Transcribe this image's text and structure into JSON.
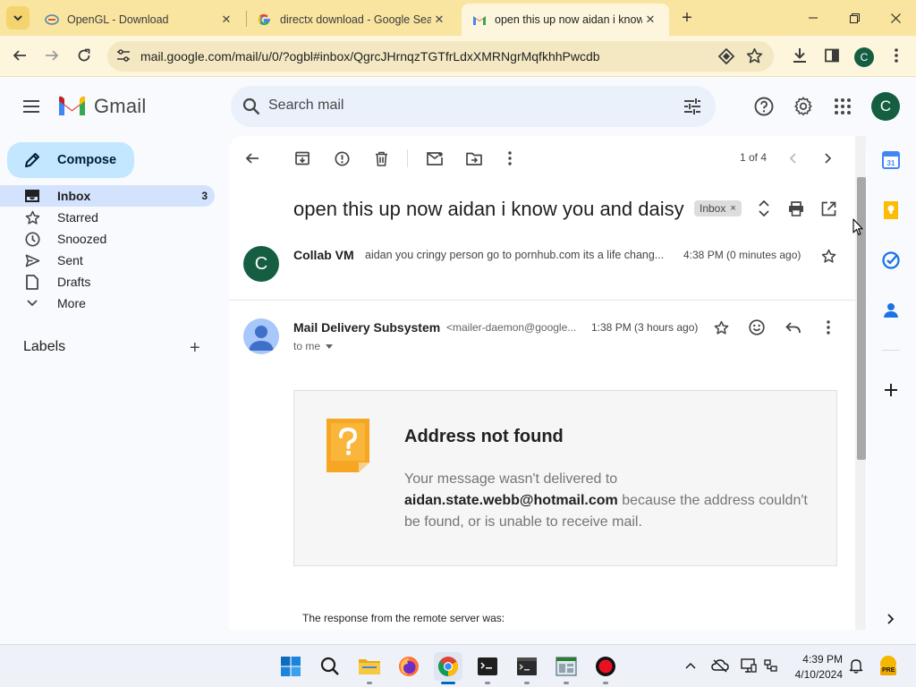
{
  "browser": {
    "tabs": [
      {
        "title": "OpenGL - Download",
        "favicon": "opengl-icon",
        "active": false
      },
      {
        "title": "directx download - Google Sea",
        "favicon": "google-icon",
        "active": false
      },
      {
        "title": "open this up now aidan i know",
        "favicon": "gmail-icon",
        "active": true
      }
    ],
    "close_glyph": "✕",
    "new_tab_glyph": "+",
    "url": "mail.google.com/mail/u/0/?ogbl#inbox/QgrcJHrnqzTGTfrLdxXMRNgrMqfkhhPwcdb",
    "profile_initial": "C"
  },
  "gmail": {
    "logo_text": "Gmail",
    "search_placeholder": "Search mail",
    "avatar_initial": "C",
    "compose_label": "Compose",
    "nav": [
      {
        "label": "Inbox",
        "icon": "inbox-icon",
        "count": "3",
        "active": true
      },
      {
        "label": "Starred",
        "icon": "star-icon",
        "count": "",
        "active": false
      },
      {
        "label": "Snoozed",
        "icon": "clock-icon",
        "count": "",
        "active": false
      },
      {
        "label": "Sent",
        "icon": "send-icon",
        "count": "",
        "active": false
      },
      {
        "label": "Drafts",
        "icon": "draft-icon",
        "count": "",
        "active": false
      },
      {
        "label": "More",
        "icon": "chevron-down-icon",
        "count": "",
        "active": false
      }
    ],
    "labels_heading": "Labels",
    "labels_add": "+"
  },
  "thread": {
    "pager": "1 of 4",
    "subject": "open this up now aidan i know you and daisy",
    "label_chip": "Inbox",
    "label_chip_close": "×",
    "messages": [
      {
        "sender": "Collab VM",
        "avatar_initial": "C",
        "snippet": "aidan you cringy person go to pornhub.com its a life chang...",
        "time": "4:38 PM (0 minutes ago)"
      },
      {
        "sender": "Mail Delivery Subsystem",
        "email": "<mailer-daemon@google...",
        "time": "1:38 PM (3 hours ago)",
        "to": "to me"
      }
    ],
    "bounce": {
      "heading": "Address not found",
      "line1": "Your message wasn't delivered to",
      "address": "aidan.state.webb@hotmail.com",
      "line2": " because the address couldn't be found, or is unable to receive mail."
    },
    "response_text": "The response from the remote server was:"
  },
  "taskbar": {
    "time": "4:39 PM",
    "date": "4/10/2024",
    "weather_badge": "PRE"
  },
  "colors": {
    "tabstrip": "#f9e4a0",
    "toolbar": "#fdf6dc",
    "accent_green": "#155e42",
    "compose": "#c2e7ff",
    "nav_active": "#d3e3fd"
  }
}
